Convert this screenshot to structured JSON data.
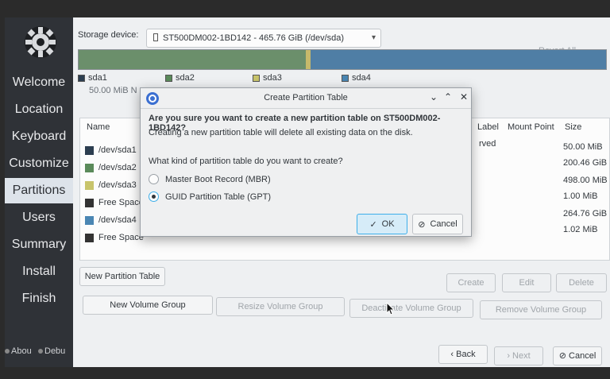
{
  "sidebar": {
    "items": [
      {
        "label": "Welcome"
      },
      {
        "label": "Location"
      },
      {
        "label": "Keyboard"
      },
      {
        "label": "Customize"
      },
      {
        "label": "Partitions"
      },
      {
        "label": "Users"
      },
      {
        "label": "Summary"
      },
      {
        "label": "Install"
      },
      {
        "label": "Finish"
      }
    ],
    "active": "Partitions",
    "about_label": "Abou",
    "debug_label": "Debu"
  },
  "storage": {
    "label": "Storage device:",
    "device": "ST500DM002-1BD142 - 465.76 GiB (/dev/sda)",
    "revert_label": "Revert All Changes"
  },
  "partition_bar": {
    "segments": [
      {
        "name": "sda2",
        "fraction": 0.43,
        "color": "#6b8f6b"
      },
      {
        "name": "sda3",
        "fraction": 0.01,
        "color": "#c7b96b"
      },
      {
        "name": "sda4",
        "fraction": 0.56,
        "color": "#4f7ea5"
      }
    ],
    "legend": [
      {
        "name": "sda1",
        "size": "50.00 MiB",
        "extra": "N",
        "color": "#2c3e50"
      },
      {
        "name": "sda2",
        "color": "#5a8a5a"
      },
      {
        "name": "sda3",
        "color": "#c8c46b"
      },
      {
        "name": "sda4",
        "color": "#4a86b3"
      }
    ]
  },
  "table": {
    "headers": {
      "name": "Name",
      "label": "Label",
      "mount": "Mount Point",
      "size": "Size"
    },
    "rows": [
      {
        "name": "/dev/sda1",
        "label": "rved",
        "size": "50.00 MiB",
        "color": "#2c3e50"
      },
      {
        "name": "/dev/sda2",
        "label": "",
        "size": "200.46 GiB",
        "color": "#5a8a5a"
      },
      {
        "name": "/dev/sda3",
        "label": "",
        "size": "498.00 MiB",
        "color": "#c8c46b"
      },
      {
        "name": "Free Space",
        "label": "",
        "size": "1.00 MiB",
        "color": "#333333"
      },
      {
        "name": "/dev/sda4",
        "label": "",
        "size": "264.76 GiB",
        "color": "#4a86b3"
      },
      {
        "name": "Free Space",
        "label": "",
        "size": "1.02 MiB",
        "color": "#333333"
      }
    ]
  },
  "buttons": {
    "new_partition_table": "New Partition Table",
    "create": "Create",
    "edit": "Edit",
    "delete": "Delete",
    "new_volume_group": "New Volume Group",
    "resize_volume_group": "Resize Volume Group",
    "deactivate_volume_group": "Deactivate Volume Group",
    "remove_volume_group": "Remove Volume Group",
    "back": "Back",
    "next": "Next",
    "cancel": "Cancel"
  },
  "dialog": {
    "title": "Create Partition Table",
    "question": "Are you sure you want to create a new partition table on ST500DM002-1BD142?",
    "info": "Creating a new partition table will delete all existing data on the disk.",
    "ask": "What kind of partition table do you want to create?",
    "options": [
      {
        "label": "Master Boot Record (MBR)",
        "selected": false
      },
      {
        "label": "GUID Partition Table (GPT)",
        "selected": true
      }
    ],
    "ok_label": "OK",
    "cancel_label": "Cancel"
  }
}
